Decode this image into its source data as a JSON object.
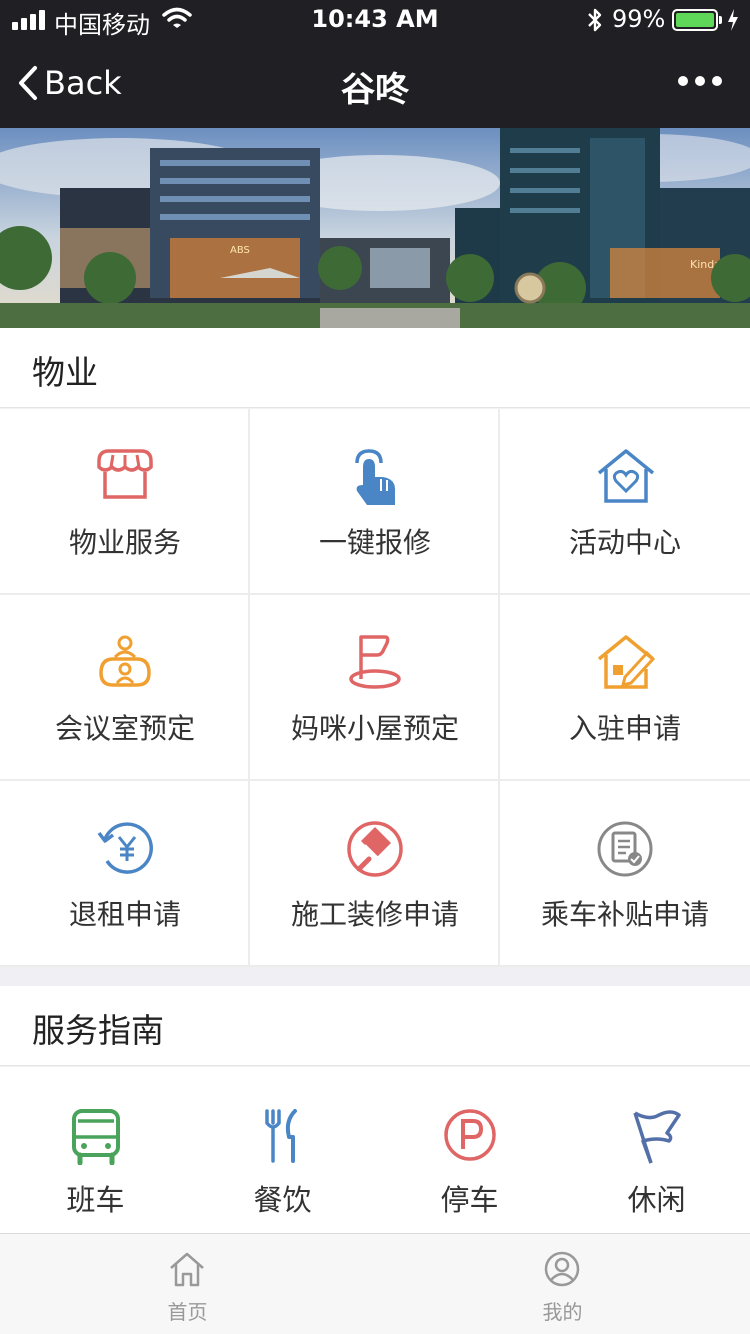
{
  "status": {
    "carrier": "中国移动",
    "time": "10:43 AM",
    "battery": "99%",
    "battery_level": 0.99
  },
  "nav": {
    "back": "Back",
    "title": "谷咚"
  },
  "banner": {
    "sign_left": "ABS",
    "sign_right": "Kinda"
  },
  "property": {
    "heading": "物业",
    "items": [
      {
        "label": "物业服务",
        "icon": "storefront-icon",
        "color": "#e06565"
      },
      {
        "label": "一键报修",
        "icon": "tap-hand-icon",
        "color": "#4a86c5"
      },
      {
        "label": "活动中心",
        "icon": "house-heart-icon",
        "color": "#4a86c5"
      },
      {
        "label": "会议室预定",
        "icon": "meeting-people-icon",
        "color": "#f0a030"
      },
      {
        "label": "妈咪小屋预定",
        "icon": "flag-icon",
        "color": "#e06565"
      },
      {
        "label": "入驻申请",
        "icon": "house-pen-icon",
        "color": "#f0a030"
      },
      {
        "label": "退租申请",
        "icon": "yen-refund-icon",
        "color": "#4a86c5"
      },
      {
        "label": "施工装修申请",
        "icon": "paint-roller-icon",
        "color": "#e06565"
      },
      {
        "label": "乘车补贴申请",
        "icon": "document-check-icon",
        "color": "#888888"
      }
    ]
  },
  "guide": {
    "heading": "服务指南",
    "items": [
      {
        "label": "班车",
        "icon": "bus-icon",
        "color": "#4aa35a"
      },
      {
        "label": "餐饮",
        "icon": "fork-knife-icon",
        "color": "#4a86c5"
      },
      {
        "label": "停车",
        "icon": "parking-icon",
        "color": "#e06565"
      },
      {
        "label": "休闲",
        "icon": "pennant-flag-icon",
        "color": "#5470a8"
      }
    ]
  },
  "tabs": [
    {
      "label": "首页",
      "icon": "home-icon"
    },
    {
      "label": "我的",
      "icon": "user-icon"
    }
  ]
}
